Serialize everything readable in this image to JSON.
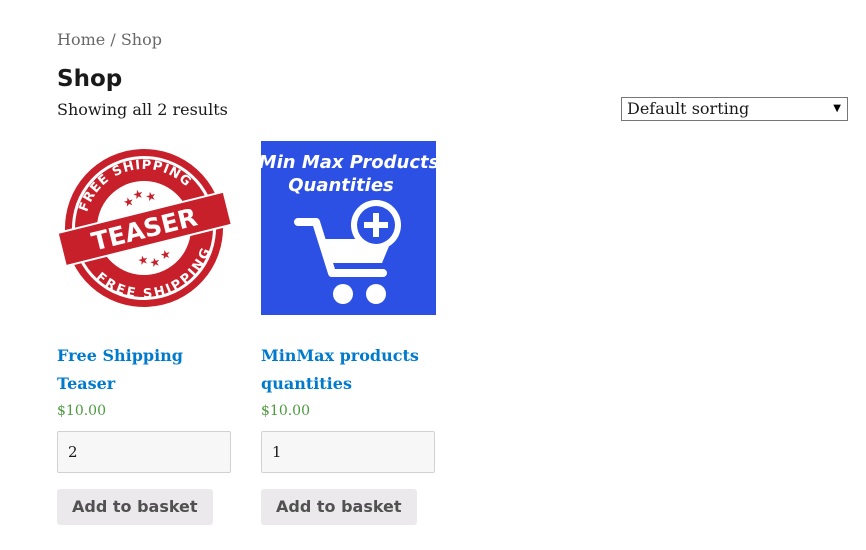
{
  "breadcrumb": {
    "home": "Home",
    "separator": "/",
    "current": "Shop"
  },
  "page": {
    "title": "Shop",
    "result_count": "Showing all 2 results"
  },
  "sorting": {
    "selected": "Default sorting"
  },
  "products": [
    {
      "name": "Free Shipping Teaser",
      "price": "$10.00",
      "quantity": "2",
      "button": "Add to basket",
      "image_text": {
        "top": "FREE SHIPPING",
        "middle": "TEASER",
        "bottom": "FREE SHIPPING"
      }
    },
    {
      "name": "MinMax products quantities",
      "price": "$10.00",
      "quantity": "1",
      "button": "Add to basket",
      "image_text": {
        "line1": "Min Max Products",
        "line2": "Quantities"
      }
    }
  ],
  "colors": {
    "link": "#007acc",
    "price": "#4d9a3f",
    "stamp_red": "#c8202a",
    "product_blue": "#2b50e3",
    "button_bg": "#ebe9eb"
  }
}
